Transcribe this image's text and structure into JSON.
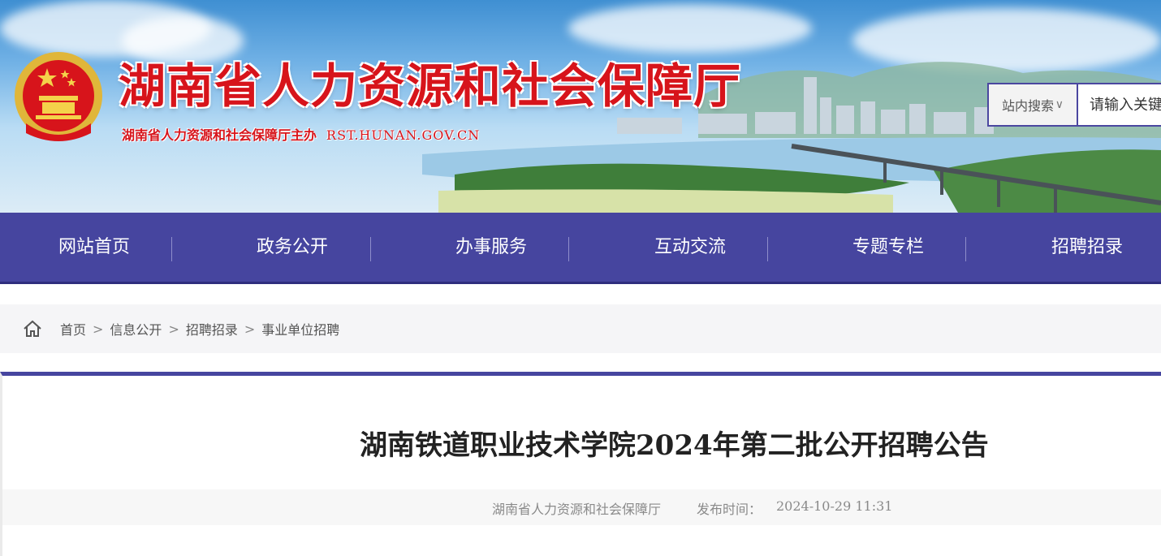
{
  "header": {
    "site_title": "湖南省人力资源和社会保障厅",
    "sponsor": "湖南省人力资源和社会保障厅主办",
    "domain": "RST.HUNAN.GOV.CN",
    "emblem_icon": "national-emblem-icon",
    "search": {
      "scope": "站内搜索",
      "placeholder": "请输入关键字"
    }
  },
  "nav": {
    "items": [
      {
        "label": "网站首页"
      },
      {
        "label": "政务公开"
      },
      {
        "label": "办事服务"
      },
      {
        "label": "互动交流"
      },
      {
        "label": "专题专栏"
      },
      {
        "label": "招聘招录"
      }
    ]
  },
  "breadcrumb": {
    "home_icon": "home-icon",
    "items": [
      "首页",
      "信息公开",
      "招聘招录",
      "事业单位招聘"
    ],
    "separator": ">"
  },
  "article": {
    "title": "湖南铁道职业技术学院2024年第二批公开招聘公告",
    "source": "湖南省人力资源和社会保障厅",
    "publish_label": "发布时间：",
    "publish_time": "2024-10-29 11:31"
  },
  "colors": {
    "nav_bg": "#46459f",
    "title_red": "#d7141b"
  }
}
